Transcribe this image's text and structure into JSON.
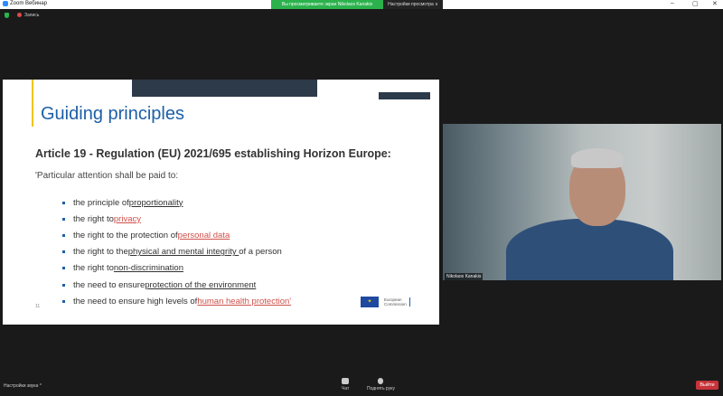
{
  "window": {
    "title": "Zoom Вебинар",
    "minimize": "–",
    "maximize": "▢",
    "close": "✕"
  },
  "banner": {
    "text": "Вы просматриваете экран Nikolaos Kanakis",
    "view_options": "Настройки просмотра ∨"
  },
  "recording": {
    "label": "Запись"
  },
  "slide": {
    "title": "Guiding principles",
    "article": "Article 19 - Regulation (EU) 2021/695 establishing Horizon Europe:",
    "intro": "'Particular attention shall be paid to:",
    "items": [
      {
        "pre": "the principle of ",
        "link": "proportionality",
        "post": "",
        "style": "u"
      },
      {
        "pre": "the right to ",
        "link": "privacy",
        "post": "",
        "style": "lnk"
      },
      {
        "pre": "the right to the protection of ",
        "link": "personal data",
        "post": "",
        "style": "lnk"
      },
      {
        "pre": "the right to the ",
        "link": "physical and mental integrity ",
        "post": "of a person",
        "style": "u"
      },
      {
        "pre": "the right to ",
        "link": "non-discrimination",
        "post": "",
        "style": "u"
      },
      {
        "pre": "the need to ensure ",
        "link": "protection of the environment",
        "post": "",
        "style": "u"
      },
      {
        "pre": "the need to ensure high levels of ",
        "link": "human health protection'",
        "post": "",
        "style": "lnk"
      }
    ],
    "page_number": "11",
    "logo_line1": "European",
    "logo_line2": "Commission"
  },
  "video": {
    "participant_name": "Nikolaos Kanakis"
  },
  "toolbar": {
    "audio_settings": "Настройки звука ^",
    "chat": "Чат",
    "raise_hand": "Поднять руку",
    "leave": "Выйти"
  }
}
